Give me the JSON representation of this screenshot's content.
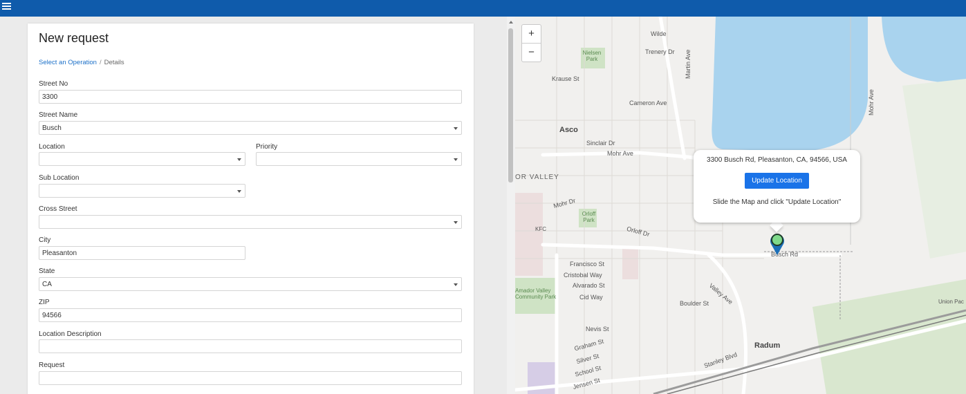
{
  "form": {
    "title": "New request",
    "breadcrumb": {
      "link": "Select an Operation",
      "separator": "/",
      "current": "Details"
    },
    "street_no": {
      "label": "Street No",
      "value": "3300"
    },
    "street_name": {
      "label": "Street Name",
      "value": "Busch"
    },
    "location": {
      "label": "Location",
      "value": ""
    },
    "priority": {
      "label": "Priority",
      "value": ""
    },
    "sub_location": {
      "label": "Sub Location",
      "value": ""
    },
    "cross_street": {
      "label": "Cross Street",
      "value": ""
    },
    "city": {
      "label": "City",
      "value": "Pleasanton"
    },
    "state": {
      "label": "State",
      "value": "CA"
    },
    "zip": {
      "label": "ZIP",
      "value": "94566"
    },
    "location_description": {
      "label": "Location Description",
      "value": ""
    },
    "request": {
      "label": "Request",
      "value": ""
    }
  },
  "map": {
    "zoom_in": "+",
    "zoom_out": "−",
    "popup": {
      "address": "3300 Busch Rd, Pleasanton, CA, 94566, USA",
      "button": "Update Location",
      "hint": "Slide the Map and click \"Update Location\""
    },
    "labels": {
      "asco": "Asco",
      "radum": "Radum",
      "valley": "OR VALLEY",
      "nielsen_park": "Nielsen Park",
      "orloff_park": "Orloff Park",
      "amador_valley_park": "Amador Valley Community Park",
      "busch_rd": "Busch Rd",
      "mohr_ave": "Mohr Ave",
      "trenery_dr": "Trenery Dr",
      "wilde": "Wilde",
      "krause_st": "Krause St",
      "cameron_ave": "Cameron Ave",
      "martin_ave": "Martin Ave",
      "mohr_ave_east": "Mohr Ave",
      "sinclair_dr": "Sinclair Dr",
      "francisco_st": "Francisco St",
      "cristobal_way": "Cristobal Way",
      "alvarado_st": "Alvarado St",
      "cid_way": "Cid Way",
      "boulder_st": "Boulder St",
      "valley_ave": "Valley Ave",
      "nevis_st": "Nevis St",
      "graham_st": "Graham St",
      "silver_st": "Silver St",
      "school_st": "School St",
      "jensen_st": "Jensen St",
      "stanley_blvd": "Stanley Blvd",
      "union_pac": "Union Pac",
      "kfc": "KFC",
      "orloff_dr": "Orloff Dr",
      "mohr_dr": "Mohr Dr"
    },
    "colors": {
      "water": "#a9d3ee",
      "park": "#cfe3c5",
      "road": "#ffffff",
      "pin_head": "#7ed98a",
      "pin_body": "#1b6fb8"
    }
  },
  "colors": {
    "topbar": "#0f5bab",
    "link": "#1a6fc8",
    "button": "#1a73e8"
  }
}
